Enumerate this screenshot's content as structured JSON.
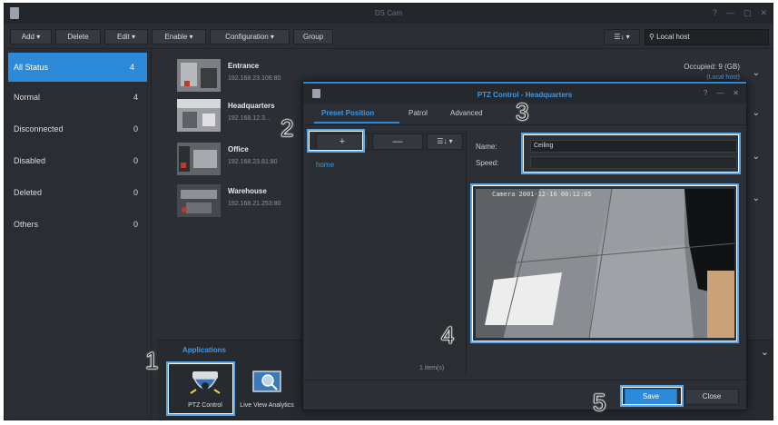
{
  "window": {
    "title": "DS Cam"
  },
  "toolbar": {
    "add": "Add ▾",
    "delete": "Delete",
    "edit": "Edit ▾",
    "enable": "Enable ▾",
    "configuration": "Configuration ▾",
    "group": "Group",
    "view": "☰↓ ▾",
    "search_value": "Local host"
  },
  "sidebar": {
    "items": [
      {
        "label": "All Status",
        "count": "4"
      },
      {
        "label": "Normal",
        "count": "4"
      },
      {
        "label": "Disconnected",
        "count": "0"
      },
      {
        "label": "Disabled",
        "count": "0"
      },
      {
        "label": "Deleted",
        "count": "0"
      },
      {
        "label": "Others",
        "count": "0"
      }
    ]
  },
  "cameras": [
    {
      "name": "Entrance",
      "ip": "192.168.23.106:80"
    },
    {
      "name": "Headquarters",
      "ip": "192.168.12.3..."
    },
    {
      "name": "Office",
      "ip": "192.168.23.81:80"
    },
    {
      "name": "Warehouse",
      "ip": "192.168.21.253:80"
    }
  ],
  "status": {
    "occupied": "Occupied: 9 (GB)",
    "local_host": "(Local host)"
  },
  "applications": {
    "title": "Applications",
    "ptz": "PTZ Control",
    "live_view": "Live View Analytics"
  },
  "dialog": {
    "title": "PTZ Control - Headquarters",
    "tabs": [
      "Preset Position",
      "Patrol",
      "Advanced"
    ],
    "add_glyph": "+",
    "remove_glyph": "—",
    "sort_glyph": "☰↓ ▾",
    "presets": [
      "home"
    ],
    "items_count": "1 item(s)",
    "name_label": "Name:",
    "name_value": "Ceiling",
    "speed_label": "Speed:",
    "preview_label": "Camera",
    "preview_timestamp": "2001-12-16 00:12:05",
    "save": "Save",
    "close": "Close"
  },
  "annotations": [
    "1",
    "2",
    "3",
    "4",
    "5"
  ],
  "colors": {
    "accent": "#2c8ad8",
    "highlight": "#5aa7ea"
  }
}
